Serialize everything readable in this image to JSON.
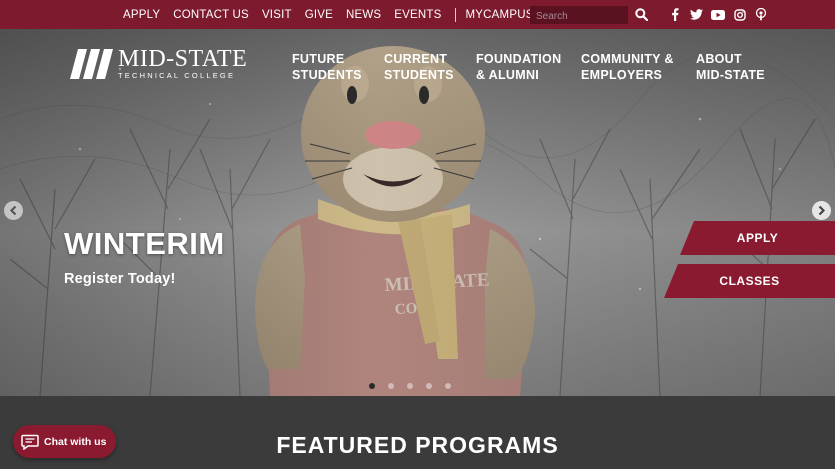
{
  "topbar": {
    "links": [
      "APPLY",
      "CONTACT US",
      "VISIT",
      "GIVE",
      "NEWS",
      "EVENTS"
    ],
    "portal_link": "MYCAMPUS LOGIN",
    "search_placeholder": "Search",
    "social_icons": [
      "facebook-icon",
      "twitter-icon",
      "youtube-icon",
      "instagram-icon",
      "podcast-icon"
    ]
  },
  "logo": {
    "name": "MID-STATE",
    "subtitle": "TECHNICAL COLLEGE"
  },
  "nav": [
    {
      "line1": "FUTURE",
      "line2": "STUDENTS"
    },
    {
      "line1": "CURRENT",
      "line2": "STUDENTS"
    },
    {
      "line1": "FOUNDATION",
      "line2": "& ALUMNI"
    },
    {
      "line1": "COMMUNITY &",
      "line2": "EMPLOYERS"
    },
    {
      "line1": "ABOUT",
      "line2": "MID-STATE"
    }
  ],
  "hero": {
    "title": "WINTERIM",
    "subtitle": "Register Today!",
    "cta_apply": "APPLY",
    "cta_classes": "CLASSES",
    "slide_count": 5,
    "active_slide": 1
  },
  "featured": {
    "heading": "FEATURED PROGRAMS"
  },
  "chat": {
    "label": "Chat with us"
  },
  "colors": {
    "brand": "#8a1a30",
    "topbar": "#7d1a2e",
    "dark": "#3b3b3b"
  }
}
